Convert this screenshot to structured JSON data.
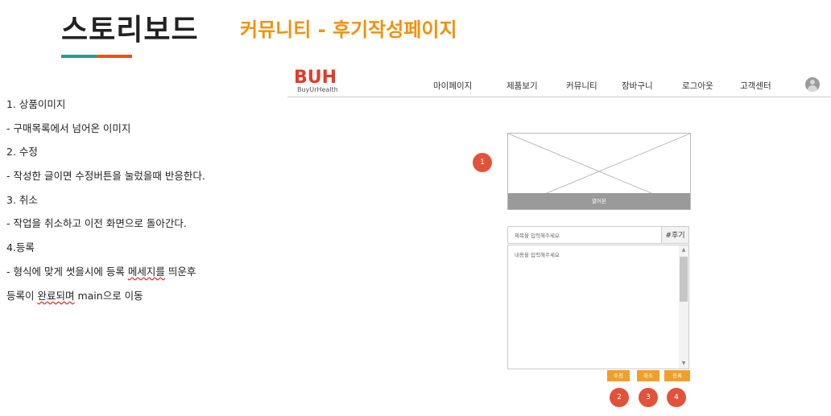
{
  "header": {
    "title": "스토리보드",
    "subtitle": "커뮤니티 - 후기작성페이지",
    "accent_colors": [
      "#2a9a8a",
      "#e8541a"
    ]
  },
  "notes": [
    "1. 상품이미지",
    "- 구매목록에서 넘어온 이미지",
    "2. 수정",
    "- 작성한 글이면 수정버튼을 눌렀을때 반응한다.",
    "3. 취소",
    "- 작업을 취소하고 이전 화면으로 돌아간다.",
    "4.등록",
    "- 형식에 맞게 썻을시에 등록 메세지를 띄운후",
    "등록이 완료되며 main으로 이동"
  ],
  "site": {
    "logo": "BUH",
    "tagline": "BuyUrHealth",
    "brand_color": "#e13c2c",
    "nav": [
      "마이페이지",
      "제품보기",
      "커뮤니티",
      "장바구니",
      "로그아웃",
      "고객센터"
    ],
    "avatar_icon": "user-icon"
  },
  "form": {
    "image_button": "열어본",
    "title_placeholder": "제목을 입력해주세요",
    "tag": "#후기",
    "content_placeholder": "내용을 입력해주세요",
    "buttons": [
      "수정",
      "취소",
      "등록"
    ],
    "button_color": "#f0a02a"
  },
  "badges": [
    "1",
    "2",
    "3",
    "4"
  ],
  "badge_color": "#e0533a"
}
